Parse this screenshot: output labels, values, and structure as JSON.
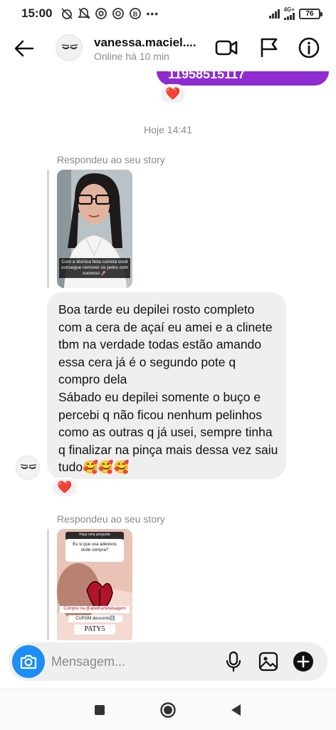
{
  "status_bar": {
    "time": "15:00",
    "network": "4G+",
    "battery": "76"
  },
  "header": {
    "username": "vanessa.maciel....",
    "status": "Online há 10 min",
    "icons": [
      "back-arrow-icon",
      "video-call-icon",
      "flag-icon",
      "info-icon"
    ]
  },
  "chat": {
    "sent_message_partial": "11958515117",
    "day_separator": "Hoje 14:41",
    "story_reply_1": {
      "label": "Respondeu ao seu story",
      "caption": "Com a técnica feita correta você consegue remover os pelos com sucesso 🚀"
    },
    "message_text": "Boa tarde eu depilei rosto completo com a cera de açaí eu amei e a clinete tbm na verdade todas estão amando essa cera já é o segundo pote q compro dela\nSábado eu depilei somente o buço e percebi q não ficou nenhum pelinhos como as outras q já usei, sempre tinha q finalizar na pinça mais dessa vez saiu tudo🥰🥰🥰",
    "reaction": "❤️",
    "story_reply_2": {
      "label": "Respondeu ao seu story",
      "question_title": "Faça uma pergunta",
      "question": "Eu si que usa adesivos onde compra?",
      "tag": "Compre na @abelhartetatuagem",
      "coupon": "CUPOM desconto⬇️",
      "code": "PATY5"
    }
  },
  "composer": {
    "placeholder": "Mensagem..."
  },
  "colors": {
    "accent_blue": "#1c8ef5",
    "sent_bubble": "#8e2bd1",
    "received_bubble": "#efefef",
    "heart": "#e0132a"
  }
}
